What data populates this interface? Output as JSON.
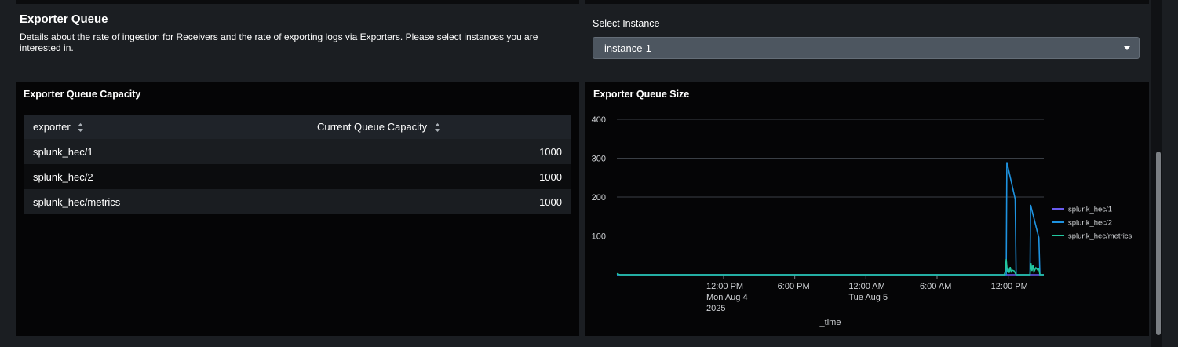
{
  "header": {
    "title": "Exporter Queue",
    "description": "Details about the rate of ingestion for Receivers and the rate of exporting logs via Exporters. Please select instances you are interested in."
  },
  "instance_select": {
    "label": "Select Instance",
    "value": "instance-1"
  },
  "capacity_panel": {
    "title": "Exporter Queue Capacity",
    "columns": [
      "exporter",
      "Current Queue Capacity"
    ],
    "rows": [
      {
        "exporter": "splunk_hec/1",
        "capacity": "1000"
      },
      {
        "exporter": "splunk_hec/2",
        "capacity": "1000"
      },
      {
        "exporter": "splunk_hec/metrics",
        "capacity": "1000"
      }
    ]
  },
  "size_panel": {
    "title": "Exporter Queue Size"
  },
  "colors": {
    "splunk_hec/1": "#6a5cf0",
    "splunk_hec/2": "#1e93e0",
    "splunk_hec/metrics": "#22c7a0",
    "background": "#1b1e22",
    "panel": "#050506"
  },
  "chart_data": {
    "type": "line",
    "title": "Exporter Queue Size",
    "xlabel": "_time",
    "ylabel": "",
    "ylim": [
      0,
      400
    ],
    "yticks": [
      100,
      200,
      300,
      400
    ],
    "x_range": [
      "2025-08-04T03:00",
      "2025-08-05T15:00"
    ],
    "xticks": [
      {
        "t": "2025-08-04T12:00",
        "label": [
          "12:00 PM",
          "Mon Aug 4",
          "2025"
        ]
      },
      {
        "t": "2025-08-04T18:00",
        "label": [
          "6:00 PM"
        ]
      },
      {
        "t": "2025-08-05T00:00",
        "label": [
          "12:00 AM",
          "Tue Aug 5"
        ]
      },
      {
        "t": "2025-08-05T06:00",
        "label": [
          "6:00 AM"
        ]
      },
      {
        "t": "2025-08-05T12:00",
        "label": [
          "12:00 PM"
        ]
      }
    ],
    "grid": true,
    "legend_position": "right",
    "series": [
      {
        "name": "splunk_hec/1",
        "points": [
          [
            "2025-08-04T03:00",
            0
          ],
          [
            "2025-08-05T15:00",
            0
          ]
        ]
      },
      {
        "name": "splunk_hec/2",
        "points": [
          [
            "2025-08-04T03:00",
            0
          ],
          [
            "2025-08-05T11:50",
            0
          ],
          [
            "2025-08-05T11:53",
            290
          ],
          [
            "2025-08-05T12:35",
            195
          ],
          [
            "2025-08-05T12:40",
            0
          ],
          [
            "2025-08-05T13:50",
            0
          ],
          [
            "2025-08-05T13:53",
            180
          ],
          [
            "2025-08-05T14:35",
            95
          ],
          [
            "2025-08-05T14:40",
            0
          ],
          [
            "2025-08-05T15:00",
            0
          ]
        ]
      },
      {
        "name": "splunk_hec/metrics",
        "points": [
          [
            "2025-08-04T03:00",
            3
          ],
          [
            "2025-08-04T03:15",
            0
          ],
          [
            "2025-08-05T11:40",
            0
          ],
          [
            "2025-08-05T11:45",
            8
          ],
          [
            "2025-08-05T11:50",
            40
          ],
          [
            "2025-08-05T11:55",
            10
          ],
          [
            "2025-08-05T12:00",
            15
          ],
          [
            "2025-08-05T12:05",
            5
          ],
          [
            "2025-08-05T12:10",
            20
          ],
          [
            "2025-08-05T12:15",
            8
          ],
          [
            "2025-08-05T12:20",
            12
          ],
          [
            "2025-08-05T12:30",
            10
          ],
          [
            "2025-08-05T12:40",
            0
          ],
          [
            "2025-08-05T13:50",
            0
          ],
          [
            "2025-08-05T13:55",
            30
          ],
          [
            "2025-08-05T14:00",
            10
          ],
          [
            "2025-08-05T14:05",
            25
          ],
          [
            "2025-08-05T14:10",
            8
          ],
          [
            "2025-08-05T14:20",
            18
          ],
          [
            "2025-08-05T14:30",
            12
          ],
          [
            "2025-08-05T14:35",
            15
          ],
          [
            "2025-08-05T14:40",
            0
          ],
          [
            "2025-08-05T15:00",
            0
          ]
        ]
      }
    ]
  }
}
